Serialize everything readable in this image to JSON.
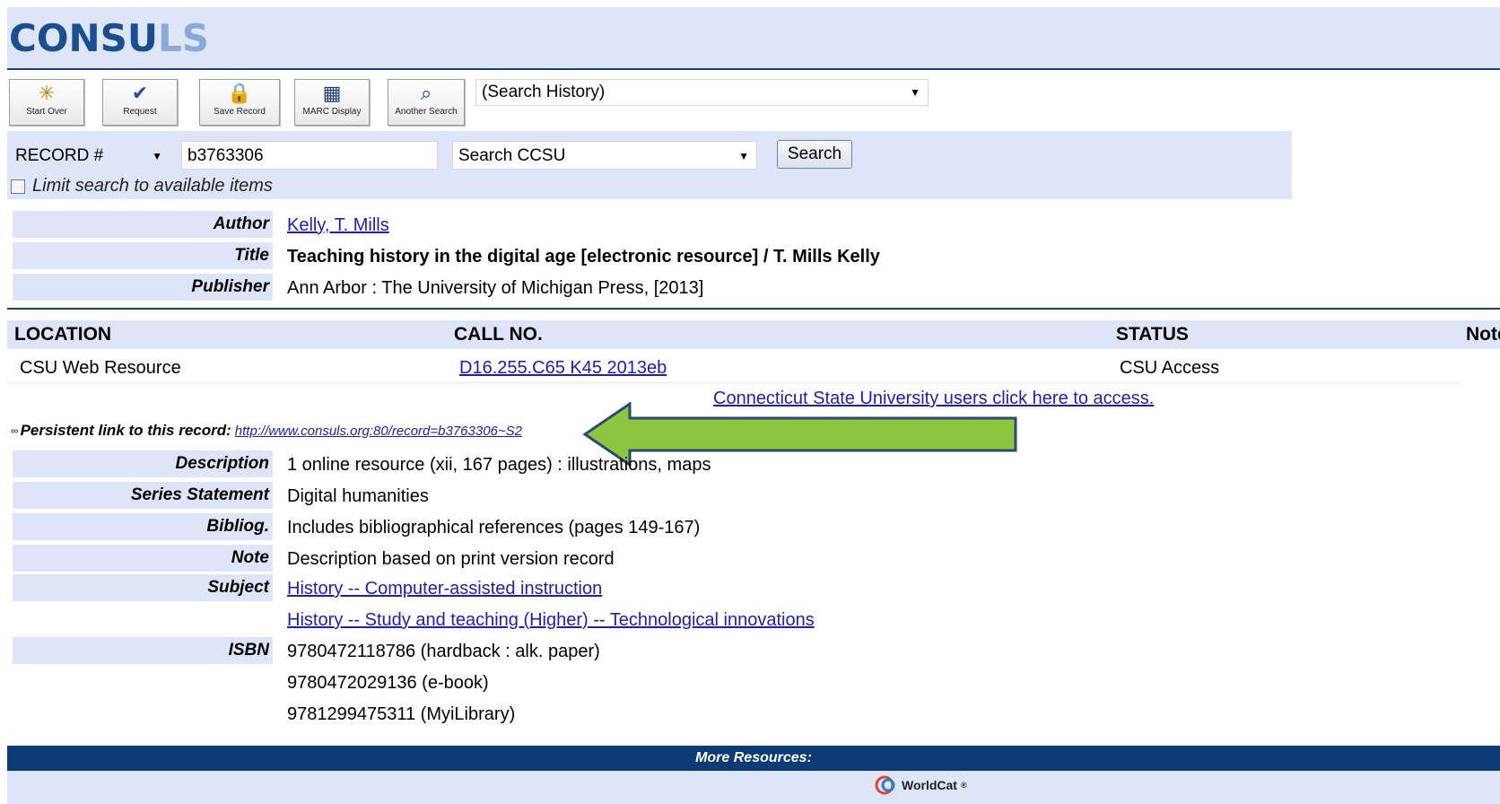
{
  "header": {
    "logo_main": "CONSU",
    "logo_tail": "LS"
  },
  "toolbar": {
    "buttons": [
      {
        "label": "Start Over",
        "icon": "star-icon"
      },
      {
        "label": "Request",
        "icon": "checkmark-icon"
      },
      {
        "label": "Save Record",
        "icon": "lock-icon"
      },
      {
        "label": "MARC Display",
        "icon": "grid-icon"
      },
      {
        "label": "Another Search",
        "icon": "magnifier-icon"
      }
    ],
    "history_select": "(Search History)"
  },
  "search": {
    "field_type": "RECORD #",
    "query": "b3763306",
    "scope": "Search CCSU",
    "button": "Search",
    "limit_label": "Limit search to available items"
  },
  "record": {
    "author_label": "Author",
    "author": "Kelly, T. Mills",
    "title_label": "Title",
    "title": "Teaching history in the digital age [electronic resource] / T. Mills Kelly",
    "publisher_label": "Publisher",
    "publisher": "Ann Arbor : The University of Michigan Press, [2013]"
  },
  "holdings": {
    "headers": {
      "location": "LOCATION",
      "call_no": "CALL NO.",
      "status": "STATUS",
      "note": "Note"
    },
    "row": {
      "location": "CSU Web Resource",
      "call_no": "D16.255.C65 K45 2013eb",
      "status": "CSU Access"
    },
    "access_link": "Connecticut State University users click here to access."
  },
  "persistent": {
    "label": "Persistent link to this record:",
    "url": "http://www.consuls.org:80/record=b3763306~S2"
  },
  "details": {
    "description_label": "Description",
    "description": "1 online resource (xii, 167 pages) : illustrations, maps",
    "series_label": "Series Statement",
    "series": "Digital humanities",
    "bibliog_label": "Bibliog.",
    "bibliog": "Includes bibliographical references (pages 149-167)",
    "note_label": "Note",
    "note": "Description based on print version record",
    "subject_label": "Subject",
    "subjects": [
      "History -- Computer-assisted instruction",
      "History -- Study and teaching (Higher) -- Technological innovations"
    ],
    "isbn_label": "ISBN",
    "isbns": [
      "9780472118786 (hardback : alk. paper)",
      "9780472029136 (e-book)",
      "9781299475311 (MyiLibrary)"
    ]
  },
  "footer": {
    "more_resources": "More Resources:",
    "worldcat": "WorldCat"
  },
  "colors": {
    "panel": "#dce6f8",
    "navy": "#0d3b76",
    "arrow": "#8dc63f"
  }
}
